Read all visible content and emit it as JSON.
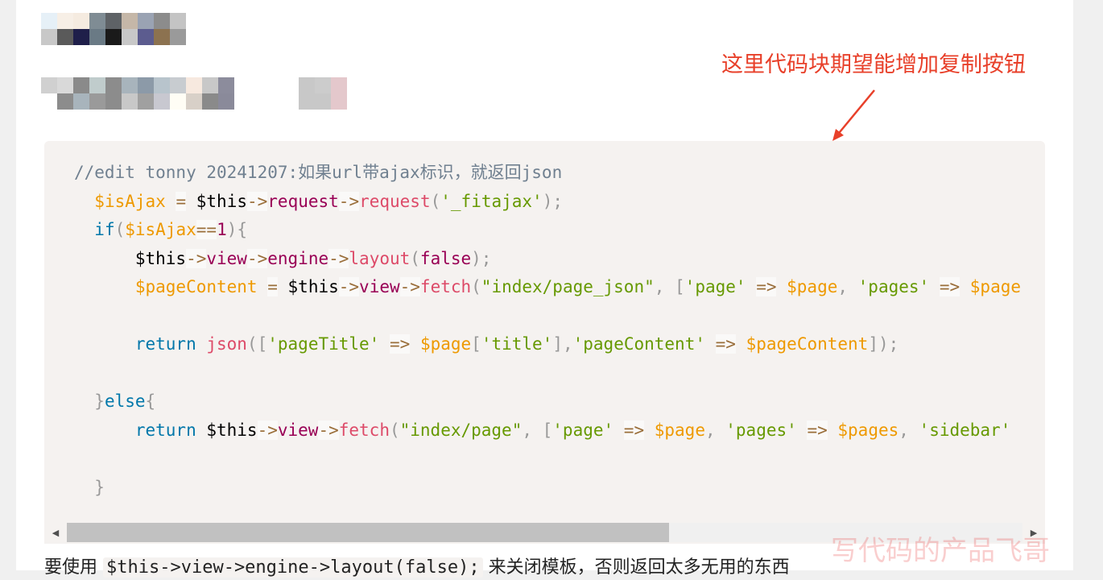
{
  "annotation": {
    "text": "这里代码块期望能增加复制按钮",
    "color": "#e8402a"
  },
  "code": {
    "lines": [
      [
        {
          "t": "//edit tonny 20241207:如果url带ajax标识，就返回json",
          "c": "comment"
        }
      ],
      [
        {
          "t": "  ",
          "c": ""
        },
        {
          "t": "$isAjax",
          "c": "var"
        },
        {
          "t": " ",
          "c": ""
        },
        {
          "t": "=",
          "c": "op"
        },
        {
          "t": " $this",
          "c": ""
        },
        {
          "t": "->",
          "c": "op"
        },
        {
          "t": "request",
          "c": "prop"
        },
        {
          "t": "->",
          "c": "op"
        },
        {
          "t": "request",
          "c": "fn"
        },
        {
          "t": "(",
          "c": "punc"
        },
        {
          "t": "'_fitajax'",
          "c": "str"
        },
        {
          "t": ");",
          "c": "punc"
        }
      ],
      [
        {
          "t": "  ",
          "c": ""
        },
        {
          "t": "if",
          "c": "kw"
        },
        {
          "t": "(",
          "c": "punc"
        },
        {
          "t": "$isAjax",
          "c": "var"
        },
        {
          "t": "==",
          "c": "op"
        },
        {
          "t": "1",
          "c": "num"
        },
        {
          "t": "){",
          "c": "punc"
        }
      ],
      [
        {
          "t": "      $this",
          "c": ""
        },
        {
          "t": "->",
          "c": "op"
        },
        {
          "t": "view",
          "c": "prop"
        },
        {
          "t": "->",
          "c": "op"
        },
        {
          "t": "engine",
          "c": "prop"
        },
        {
          "t": "->",
          "c": "op"
        },
        {
          "t": "layout",
          "c": "fn"
        },
        {
          "t": "(",
          "c": "punc"
        },
        {
          "t": "false",
          "c": "bool"
        },
        {
          "t": ");",
          "c": "punc"
        }
      ],
      [
        {
          "t": "      ",
          "c": ""
        },
        {
          "t": "$pageContent",
          "c": "var"
        },
        {
          "t": " ",
          "c": ""
        },
        {
          "t": "=",
          "c": "op"
        },
        {
          "t": " $this",
          "c": ""
        },
        {
          "t": "->",
          "c": "op"
        },
        {
          "t": "view",
          "c": "prop"
        },
        {
          "t": "->",
          "c": "op"
        },
        {
          "t": "fetch",
          "c": "fn"
        },
        {
          "t": "(",
          "c": "punc"
        },
        {
          "t": "\"index/page_json\"",
          "c": "str"
        },
        {
          "t": ", [",
          "c": "punc"
        },
        {
          "t": "'page'",
          "c": "str"
        },
        {
          "t": " ",
          "c": ""
        },
        {
          "t": "=>",
          "c": "op"
        },
        {
          "t": " ",
          "c": ""
        },
        {
          "t": "$page",
          "c": "var"
        },
        {
          "t": ", ",
          "c": "punc"
        },
        {
          "t": "'pages'",
          "c": "str"
        },
        {
          "t": " ",
          "c": ""
        },
        {
          "t": "=>",
          "c": "op"
        },
        {
          "t": " ",
          "c": ""
        },
        {
          "t": "$page",
          "c": "var"
        }
      ],
      [
        {
          "t": "",
          "c": ""
        }
      ],
      [
        {
          "t": "      ",
          "c": ""
        },
        {
          "t": "return",
          "c": "kw"
        },
        {
          "t": " ",
          "c": ""
        },
        {
          "t": "json",
          "c": "fn"
        },
        {
          "t": "([",
          "c": "punc"
        },
        {
          "t": "'pageTitle'",
          "c": "str"
        },
        {
          "t": " ",
          "c": ""
        },
        {
          "t": "=>",
          "c": "op"
        },
        {
          "t": " ",
          "c": ""
        },
        {
          "t": "$page",
          "c": "var"
        },
        {
          "t": "[",
          "c": "punc"
        },
        {
          "t": "'title'",
          "c": "str"
        },
        {
          "t": "],",
          "c": "punc"
        },
        {
          "t": "'pageContent'",
          "c": "str"
        },
        {
          "t": " ",
          "c": ""
        },
        {
          "t": "=>",
          "c": "op"
        },
        {
          "t": " ",
          "c": ""
        },
        {
          "t": "$pageContent",
          "c": "var"
        },
        {
          "t": "]);",
          "c": "punc"
        }
      ],
      [
        {
          "t": "",
          "c": ""
        }
      ],
      [
        {
          "t": "  ",
          "c": ""
        },
        {
          "t": "}",
          "c": "punc"
        },
        {
          "t": "else",
          "c": "kw"
        },
        {
          "t": "{",
          "c": "punc"
        }
      ],
      [
        {
          "t": "      ",
          "c": ""
        },
        {
          "t": "return",
          "c": "kw"
        },
        {
          "t": " $this",
          "c": ""
        },
        {
          "t": "->",
          "c": "op"
        },
        {
          "t": "view",
          "c": "prop"
        },
        {
          "t": "->",
          "c": "op"
        },
        {
          "t": "fetch",
          "c": "fn"
        },
        {
          "t": "(",
          "c": "punc"
        },
        {
          "t": "\"index/page\"",
          "c": "str"
        },
        {
          "t": ", [",
          "c": "punc"
        },
        {
          "t": "'page'",
          "c": "str"
        },
        {
          "t": " ",
          "c": ""
        },
        {
          "t": "=>",
          "c": "op"
        },
        {
          "t": " ",
          "c": ""
        },
        {
          "t": "$page",
          "c": "var"
        },
        {
          "t": ", ",
          "c": "punc"
        },
        {
          "t": "'pages'",
          "c": "str"
        },
        {
          "t": " ",
          "c": ""
        },
        {
          "t": "=>",
          "c": "op"
        },
        {
          "t": " ",
          "c": ""
        },
        {
          "t": "$pages",
          "c": "var"
        },
        {
          "t": ", ",
          "c": "punc"
        },
        {
          "t": "'sidebar'",
          "c": "str"
        }
      ],
      [
        {
          "t": "",
          "c": ""
        }
      ],
      [
        {
          "t": "  ",
          "c": ""
        },
        {
          "t": "}",
          "c": "punc"
        }
      ]
    ]
  },
  "scrollbar": {
    "position_fraction": 0.0,
    "visible_fraction": 0.63
  },
  "bottom_text": {
    "before": "要使用 ",
    "code": "$this->view->engine->layout(false);",
    "after": " 来关闭模板，否则返回太多无用的东西"
  },
  "watermark": {
    "text": "写代码的产品飞哥"
  },
  "mosaic_colors": {
    "title": [
      "#e6f0f7",
      "#f7efe6",
      "#f5ebe0",
      "#7f8c94",
      "#5e6266",
      "#c5b7a8",
      "#9aa3b3",
      "#8c8c8c",
      "#c4c4c4",
      "#c8c8c8",
      "#5a5a5a",
      "#1f1f4a",
      "#6a7a85",
      "#1a1a1a",
      "#c8c8c8",
      "#5c5c8f",
      "#8c7250",
      "#9a9a9a"
    ],
    "subtitle": [
      "#d0d0d0",
      "#d9d9d9",
      "#8a8a8a",
      "#c0cccc",
      "#8c8c8c",
      "#a8b4bc",
      "#8c9aa8",
      "#b8c4cc",
      "#c8ccd0",
      "#f7e9df",
      "#c8c8c8",
      "#8c8c9c",
      "#ffffff",
      "#8c8c8c",
      "#a8b4bc",
      "#9a9a9a",
      "#8c8c8c",
      "#c8c8c8",
      "#a0a0a0",
      "#c8c8d0",
      "#fffdf5",
      "#d8d0c8",
      "#8a8a8a",
      "#8a8a9a"
    ],
    "tag": [
      "#c8c8c8",
      "#cccccc",
      "#e4c8cc",
      "#c8c8c8",
      "#c8c8c8",
      "#e4c8cc"
    ]
  }
}
